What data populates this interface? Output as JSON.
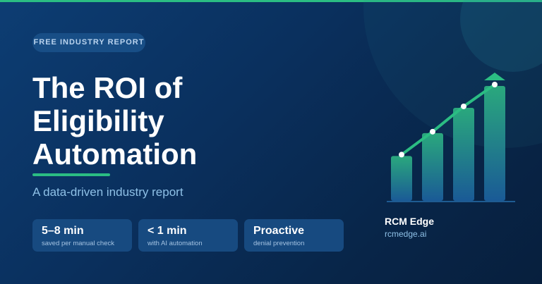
{
  "badge": {
    "label": "FREE INDUSTRY REPORT"
  },
  "headline": {
    "line_1": "The ROI of",
    "line_2": "Eligibility",
    "line_3": "Automation"
  },
  "subtitle": "A data-driven industry report",
  "stats": [
    {
      "value": "5–8 min",
      "label": "saved per manual check"
    },
    {
      "value": "< 1 min",
      "label": "with AI automation"
    },
    {
      "value": "Proactive",
      "label": "denial prevention"
    }
  ],
  "brand": {
    "name": "RCM Edge",
    "url": "rcmedge.ai"
  },
  "colors": {
    "accent": "#2bbd83",
    "background": "#0a305e",
    "card": "#174a80",
    "muted_text": "#8ec0e6"
  },
  "illustration": {
    "icon": "rising-bar-chart-with-trend-arrow",
    "bar_levels": [
      0.39,
      0.59,
      0.81,
      1.0
    ]
  }
}
